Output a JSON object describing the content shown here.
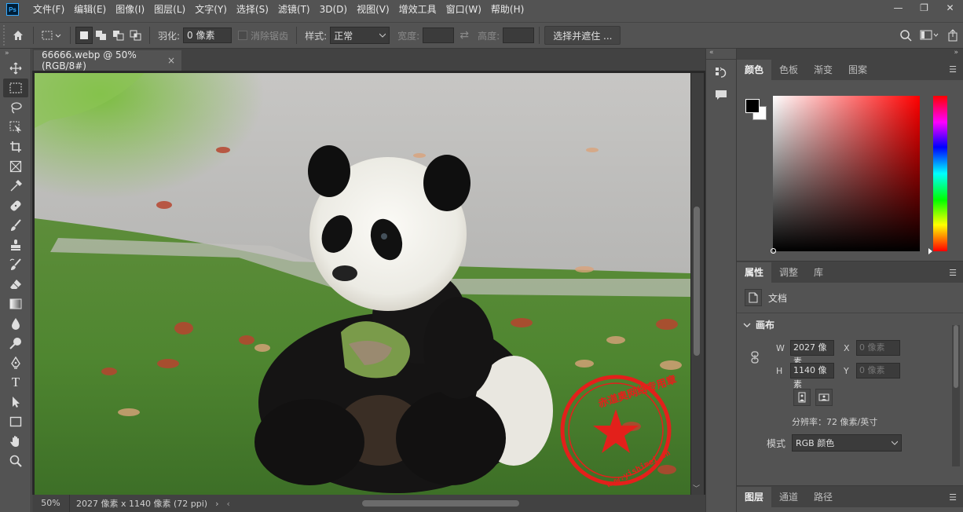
{
  "menubar": {
    "logo": "Ps",
    "items": [
      "文件(F)",
      "编辑(E)",
      "图像(I)",
      "图层(L)",
      "文字(Y)",
      "选择(S)",
      "滤镜(T)",
      "3D(D)",
      "视图(V)",
      "增效工具",
      "窗口(W)",
      "帮助(H)"
    ],
    "window_controls": [
      "—",
      "❐",
      "✕"
    ]
  },
  "options": {
    "feather_label": "羽化:",
    "feather_value": "0 像素",
    "antialias_label": "消除锯齿",
    "style_label": "样式:",
    "style_value": "正常",
    "width_label": "宽度:",
    "height_label": "高度:",
    "select_mask_button": "选择并遮住 ..."
  },
  "document": {
    "tab_title": "66666.webp @ 50%(RGB/8#)",
    "tab_close": "×",
    "zoom": "50%",
    "info": "2027 像素 x 1140 像素 (72 ppi)",
    "info_arrow": "›",
    "hscroll_left": "‹",
    "scroll_up": "︿",
    "scroll_down": "﹀"
  },
  "watermark": {
    "text": "赤道奥网络专用章",
    "url": "www.yishimei.cn"
  },
  "color_panel": {
    "tabs": [
      "颜色",
      "色板",
      "渐变",
      "图案"
    ],
    "active_tab": 0,
    "foreground": "#000000",
    "background": "#ffffff"
  },
  "properties_panel": {
    "tabs": [
      "属性",
      "调整",
      "库"
    ],
    "active_tab": 0,
    "doc_label": "文档",
    "canvas_label": "画布",
    "w_label": "W",
    "w_value": "2027 像素",
    "h_label": "H",
    "h_value": "1140 像素",
    "x_label": "X",
    "x_placeholder": "0 像素",
    "y_label": "Y",
    "y_placeholder": "0 像素",
    "resolution": "分辨率：72 像素/英寸",
    "mode_label": "模式",
    "mode_value": "RGB 颜色"
  },
  "layers_panel": {
    "tabs": [
      "图层",
      "通道",
      "路径"
    ],
    "active_tab": 0
  }
}
